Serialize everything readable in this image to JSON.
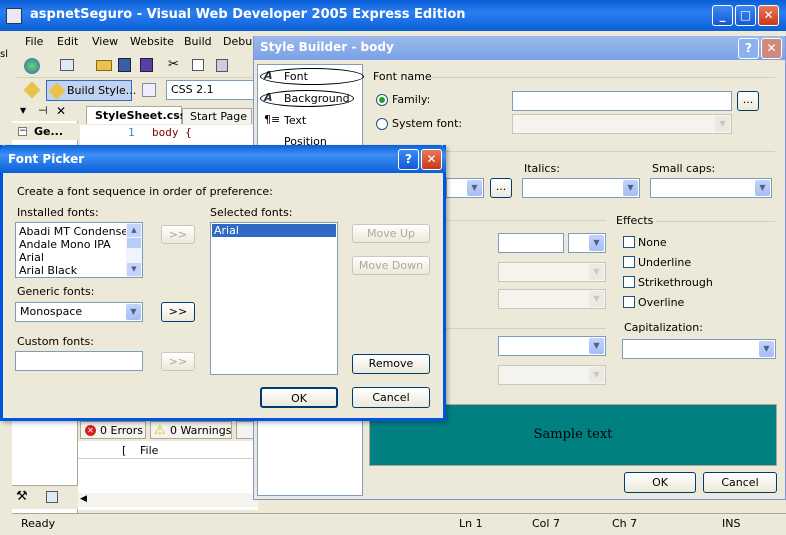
{
  "vs": {
    "title": "aspnetSeguro - Visual Web Developer 2005 Express Edition",
    "menu": [
      "File",
      "Edit",
      "View",
      "Website",
      "Build",
      "Debug"
    ],
    "build_style_label": "Build Style...",
    "css_version": "CSS 2.1",
    "doc_tabs": [
      "StyleSheet.css",
      "Start Page"
    ],
    "line_number": "1",
    "code_text": "body {",
    "solution_item": "Ge...",
    "errors_label": "0 Errors",
    "warnings_label": "0 Warnings",
    "error_columns": [
      "File"
    ],
    "status": {
      "ready": "Ready",
      "ln": "Ln 1",
      "col": "Col 7",
      "ch": "Ch 7",
      "mode": "INS"
    }
  },
  "style_builder": {
    "title": "Style Builder - body",
    "nav": [
      "Font",
      "Background",
      "Text",
      "Position"
    ],
    "font_name_group": "Font name",
    "family_label": "Family:",
    "system_font_label": "System font:",
    "browse_label": "...",
    "italics_label": "Italics:",
    "small_caps_label": "Small caps:",
    "effects_group": "Effects",
    "effects": [
      "None",
      "Underline",
      "Strikethrough",
      "Overline"
    ],
    "capitalization_label": "Capitalization:",
    "sample_text": "Sample text",
    "sample_bg": "#008080",
    "ok_label": "OK",
    "cancel_label": "Cancel"
  },
  "font_picker": {
    "title": "Font Picker",
    "instructions": "Create a font sequence in order of preference:",
    "installed_label": "Installed fonts:",
    "installed_fonts": [
      "Abadi MT Condensed",
      "Andale Mono IPA",
      "Arial",
      "Arial Black"
    ],
    "selected_label": "Selected fonts:",
    "selected_fonts": [
      "Arial"
    ],
    "generic_label": "Generic fonts:",
    "generic_value": "Monospace",
    "custom_label": "Custom fonts:",
    "add_label": ">>",
    "move_up_label": "Move Up",
    "move_down_label": "Move Down",
    "remove_label": "Remove",
    "ok_label": "OK",
    "cancel_label": "Cancel"
  },
  "colors": {
    "xp_title_blue": "#0a5fd6",
    "selection": "#316ac5",
    "dialog_bg": "#ece9d8"
  }
}
